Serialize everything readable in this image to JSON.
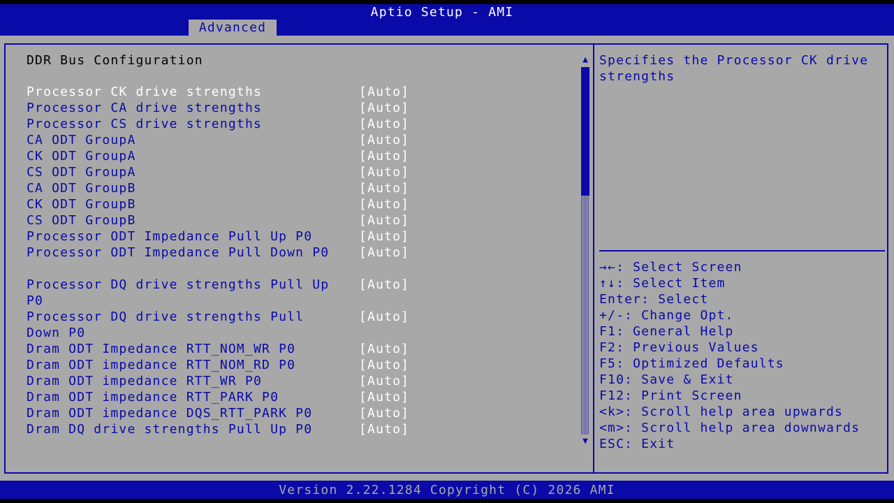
{
  "header": {
    "title": "Aptio Setup - AMI",
    "tab": "Advanced"
  },
  "section_title": "DDR Bus Configuration",
  "menu": [
    {
      "label": "Processor CK drive strengths",
      "value": "[Auto]",
      "selected": true
    },
    {
      "label": "Processor CA drive strengths",
      "value": "[Auto]"
    },
    {
      "label": "Processor CS drive strengths",
      "value": "[Auto]"
    },
    {
      "label": "CA ODT GroupA",
      "value": "[Auto]"
    },
    {
      "label": "CK ODT GroupA",
      "value": "[Auto]"
    },
    {
      "label": "CS ODT GroupA",
      "value": "[Auto]"
    },
    {
      "label": "CA ODT GroupB",
      "value": "[Auto]"
    },
    {
      "label": "CK ODT GroupB",
      "value": "[Auto]"
    },
    {
      "label": "CS ODT GroupB",
      "value": "[Auto]"
    },
    {
      "label": "Processor ODT Impedance Pull Up P0",
      "value": "[Auto]"
    },
    {
      "label": "Processor ODT Impedance Pull Down P0",
      "value": "[Auto]",
      "wrap": true
    },
    {
      "label": "Processor DQ drive strengths Pull Up P0",
      "value": "[Auto]",
      "wrap": true
    },
    {
      "label": "Processor DQ drive strengths Pull Down P0",
      "value": "[Auto]",
      "wrap": true
    },
    {
      "label": "Dram ODT Impedance RTT_NOM_WR P0",
      "value": "[Auto]"
    },
    {
      "label": "Dram ODT impedance RTT_NOM_RD P0",
      "value": "[Auto]"
    },
    {
      "label": "Dram ODT impedance RTT_WR P0",
      "value": "[Auto]"
    },
    {
      "label": "Dram ODT impedance RTT_PARK P0",
      "value": "[Auto]"
    },
    {
      "label": "Dram ODT impedance DQS_RTT_PARK P0",
      "value": "[Auto]"
    },
    {
      "label": "Dram DQ drive strengths Pull Up P0",
      "value": "[Auto]"
    }
  ],
  "help": {
    "text": "Specifies the Processor CK drive strengths"
  },
  "keys": [
    "→←: Select Screen",
    "↑↓: Select Item",
    "Enter: Select",
    "+/-: Change Opt.",
    "F1: General Help",
    "F2: Previous Values",
    "F5: Optimized Defaults",
    "F10: Save & Exit",
    "F12: Print Screen",
    "<k>: Scroll help area upwards",
    "<m>: Scroll help area downwards",
    "ESC: Exit"
  ],
  "scrollbar": {
    "up_icon": "arrow-up-icon",
    "down_icon": "arrow-down-icon",
    "visible_fraction": 0.35
  },
  "footer": "Version 2.22.1284 Copyright (C) 2026 AMI",
  "colors": {
    "bios_blue": "#0a0aa8",
    "bios_gray": "#a8a8a8",
    "highlight_white": "#ffffff"
  }
}
